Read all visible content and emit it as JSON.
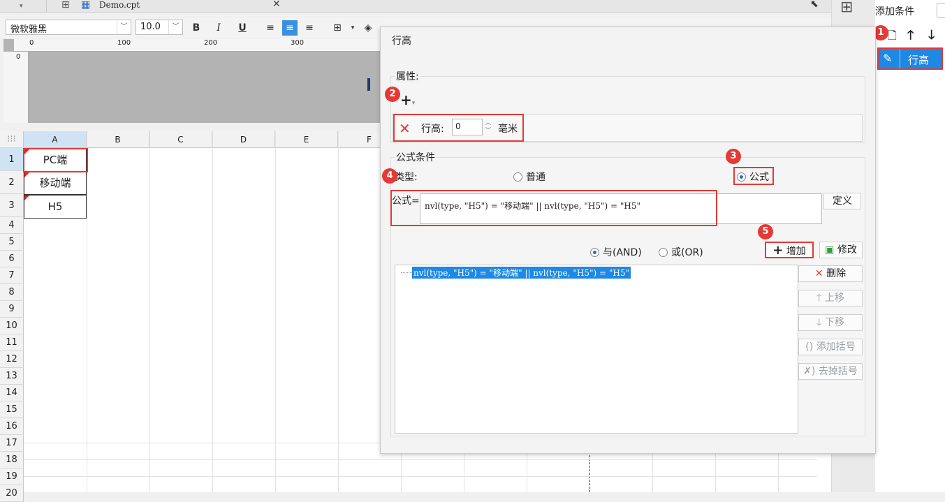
{
  "tab": {
    "file_name": "Demo.cpt"
  },
  "format_toolbar": {
    "font_family": "微软雅黑",
    "font_size": "10.0",
    "bold": "B",
    "italic": "I",
    "underline": "U"
  },
  "ruler": {
    "marks": [
      "0",
      "100",
      "200",
      "300"
    ]
  },
  "grid": {
    "columns": [
      "A",
      "B",
      "C",
      "D",
      "E",
      "F"
    ],
    "rows": [
      "1",
      "2",
      "3",
      "4",
      "5",
      "6",
      "7",
      "8",
      "9",
      "10",
      "11",
      "12",
      "13",
      "14",
      "15",
      "16",
      "17",
      "18",
      "19",
      "20"
    ],
    "cells": [
      {
        "ref": "A1",
        "value": "PC端"
      },
      {
        "ref": "A2",
        "value": "移动端"
      },
      {
        "ref": "A3",
        "value": "H5"
      }
    ]
  },
  "right_panel": {
    "title": "添加条件",
    "condition_item": "行高"
  },
  "dialog": {
    "title": "行高",
    "properties_label": "属性:",
    "property": {
      "name": "行高:",
      "value": "0",
      "unit": "毫米"
    },
    "formula_section_label": "公式条件",
    "type_label": "类型:",
    "type_options": [
      "普通",
      "公式"
    ],
    "type_selected": "公式",
    "formula_label": "公式=",
    "formula_value": "nvl(type, \"H5\") = \"移动端\" || nvl(type, \"H5\") = \"H5\"",
    "define_button": "定义",
    "logic_options": [
      "与(AND)",
      "或(OR)"
    ],
    "logic_selected": "与(AND)",
    "add_button": "增加",
    "modify_button": "修改",
    "condition_list": [
      "nvl(type, \"H5\") = \"移动端\" || nvl(type, \"H5\") = \"H5\""
    ],
    "side_buttons": [
      "删除",
      "上移",
      "下移",
      "添加括号",
      "去掉括号"
    ]
  },
  "annotations": [
    "1",
    "2",
    "3",
    "4",
    "5"
  ],
  "colors": {
    "accent": "#2b6cc4",
    "highlight": "#e53935",
    "selection": "#1e88e5"
  }
}
